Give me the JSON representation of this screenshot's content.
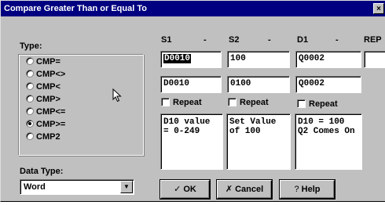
{
  "window": {
    "title": "Compare Greater Than or Equal To",
    "close": "×"
  },
  "type_group": {
    "label": "Type:",
    "options": [
      {
        "label": "CMP=",
        "selected": false
      },
      {
        "label": "CMP<>",
        "selected": false
      },
      {
        "label": "CMP<",
        "selected": false
      },
      {
        "label": "CMP>",
        "selected": false
      },
      {
        "label": "CMP<=",
        "selected": false
      },
      {
        "label": "CMP>=",
        "selected": true
      },
      {
        "label": "CMP2",
        "selected": false
      }
    ]
  },
  "data_type": {
    "label": "Data Type:",
    "value": "Word",
    "arrow": "▼"
  },
  "columns": [
    {
      "header": "S1",
      "dash": "-",
      "input": "D0010",
      "value": "D0010",
      "repeat_label": "Repeat",
      "description": "D10 value\n= 0-249"
    },
    {
      "header": "S2",
      "dash": "-",
      "input": "100",
      "value": "0100",
      "repeat_label": "Repeat",
      "description": "Set Value\nof 100"
    },
    {
      "header": "D1",
      "dash": "-",
      "input": "Q0002",
      "value": "Q0002",
      "repeat_label": "Repeat",
      "description": "D10 = 100\nQ2 Comes On"
    },
    {
      "header": "REP",
      "input": ""
    }
  ],
  "buttons": {
    "ok": {
      "icon": "✓",
      "label": "OK"
    },
    "cancel": {
      "icon": "✗",
      "label": "Cancel"
    },
    "help": {
      "icon": "?",
      "label": "Help"
    }
  }
}
